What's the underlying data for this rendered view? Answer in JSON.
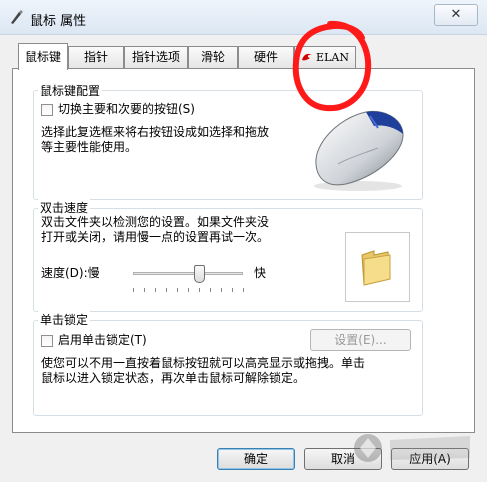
{
  "window": {
    "title": "鼠标 属性",
    "close_glyph": "✕"
  },
  "tabs": [
    {
      "label": "鼠标键",
      "active": true
    },
    {
      "label": "指针",
      "active": false
    },
    {
      "label": "指针选项",
      "active": false
    },
    {
      "label": "滑轮",
      "active": false
    },
    {
      "label": "硬件",
      "active": false
    },
    {
      "label": "ELAN",
      "active": false,
      "icon": "elan-logo-icon"
    }
  ],
  "button_config": {
    "legend": "鼠标键配置",
    "checkbox_label": "切换主要和次要的按钮(S)",
    "checked": false,
    "desc_line1": "选择此复选框来将右按钮设成如选择和拖放",
    "desc_line2": "等主要性能使用。"
  },
  "double_click": {
    "legend": "双击速度",
    "desc_line1": "双击文件夹以检测您的设置。如果文件夹没",
    "desc_line2": "打开或关闭，请用慢一点的设置再试一次。",
    "speed_label": "速度(D):慢",
    "fast_label": "快",
    "speed_value_fraction": 0.6
  },
  "click_lock": {
    "legend": "单击锁定",
    "checkbox_label": "启用单击锁定(T)",
    "checked": false,
    "settings_label": "设置(E)...",
    "desc_line1": "使您可以不用一直按着鼠标按钮就可以高亮显示或拖拽。单击",
    "desc_line2": "鼠标以进入锁定状态，再次单击鼠标可解除锁定。"
  },
  "footer": {
    "ok_label": "确定",
    "cancel_label": "取消",
    "apply_label": "应用(A)"
  },
  "annotation": {
    "color": "#ff1a1a"
  }
}
